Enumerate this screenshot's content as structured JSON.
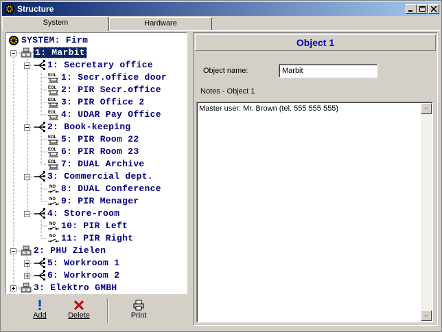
{
  "window": {
    "title": "Structure"
  },
  "tabs": [
    {
      "label": "System"
    },
    {
      "label": "Hardware"
    }
  ],
  "tree": [
    {
      "label": "SYSTEM: Firm",
      "icon": "system-icon"
    },
    {
      "label": "1: Marbit",
      "icon": "object-icon",
      "selected": true
    },
    {
      "label": "1: Secretary office",
      "icon": "group-icon"
    },
    {
      "label": "1: Secr.office door",
      "icon": "eol-input-icon"
    },
    {
      "label": "2: PIR Secr.office",
      "icon": "eol-input-icon"
    },
    {
      "label": "3: PIR Office 2",
      "icon": "eol-input-icon"
    },
    {
      "label": "4: UDAR Pay Office",
      "icon": "eol-input-icon"
    },
    {
      "label": "2: Book-keeping",
      "icon": "group-icon"
    },
    {
      "label": "5: PIR Room 22",
      "icon": "eol-input-icon"
    },
    {
      "label": "6: PIR Room 23",
      "icon": "eol-input-icon"
    },
    {
      "label": "7: DUAL Archive",
      "icon": "eol-input-icon"
    },
    {
      "label": "3: Commercial dept.",
      "icon": "group-icon"
    },
    {
      "label": "8: DUAL Conference",
      "icon": "no-input-icon"
    },
    {
      "label": "9: PIR Menager",
      "icon": "no-input-icon"
    },
    {
      "label": "4: Store-room",
      "icon": "group-icon"
    },
    {
      "label": "10: PIR Left",
      "icon": "no-input-icon"
    },
    {
      "label": "11: PIR Right",
      "icon": "no-input-icon"
    },
    {
      "label": "2: PHU Zielen",
      "icon": "object-icon"
    },
    {
      "label": "5: Workroom 1",
      "icon": "group-icon"
    },
    {
      "label": "6: Workroom 2",
      "icon": "group-icon"
    },
    {
      "label": "3: Elektro GMBH",
      "icon": "object-icon"
    }
  ],
  "toolbar": {
    "add_label": "Add",
    "delete_label": "Delete",
    "print_label": "Print"
  },
  "details": {
    "header": "Object 1",
    "name_label": "Object name:",
    "name_value": "Marbit",
    "notes_label": "Notes - Object 1",
    "notes_value": "Master user: Mr. Brown (tel. 555 555 555)"
  },
  "colors": {
    "title_start": "#0a246a",
    "title_end": "#a6caf0",
    "tree_text": "#000080",
    "header_text": "#0000c0",
    "delete_red": "#c00000"
  }
}
